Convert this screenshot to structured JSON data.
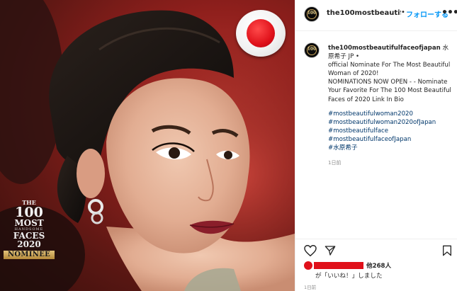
{
  "post": {
    "header": {
      "username": "the100mostbeautifu",
      "separator": "•",
      "follow_label": "フォローする",
      "more_label": "•••"
    },
    "avatar_text": "100",
    "caption": {
      "author": "the100mostbeautifulfaceofjapan",
      "author_suffix": " 水原希子",
      "author_tail": "JP •",
      "lines": [
        "official Nominate For The Most Beautiful Woman of 2020!",
        "NOMINATIONS NOW OPEN - - Nominate Your Favorite For The 100 Most Beautiful Faces of 2020 Link In Bio"
      ],
      "hashtags": [
        "#mostbeautifulwoman2020",
        "#mostbeautifulwoman2020ofJapan",
        "#mostbeautifulface",
        "#mostbeautifulfaceofJapan",
        "#水原希子"
      ],
      "time": "1日前"
    },
    "likes": {
      "others": "他268人",
      "liked_text": "が「いいね！」しました"
    },
    "timestamp": "1日前"
  },
  "photo_badge": {
    "the": "THE",
    "number": "100",
    "sub": "HANDSOME",
    "line1": "MOST",
    "line2": "FACES",
    "year": "2020",
    "nominee": "NOMINEE"
  },
  "colors": {
    "link_blue": "#0095f6",
    "hashtag": "#00376b",
    "flag_red": "#e0121b"
  }
}
